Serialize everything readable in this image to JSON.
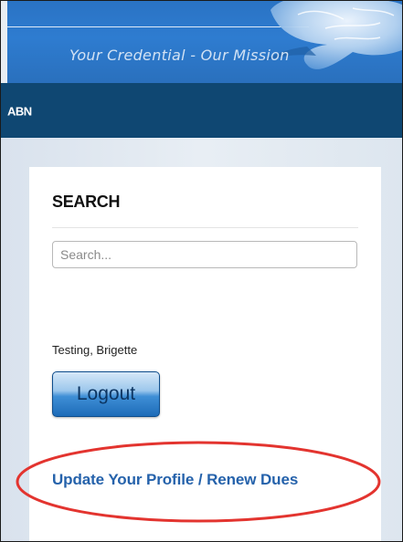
{
  "header": {
    "tagline": "Your Credential - Our Mission"
  },
  "nav": {
    "items": [
      {
        "label": "ABN"
      }
    ]
  },
  "sidebar": {
    "search": {
      "heading": "SEARCH",
      "placeholder": "Search...",
      "value": ""
    },
    "user": {
      "name": "Testing, Brigette"
    },
    "logout_label": "Logout",
    "profile_link_label": "Update Your Profile / Renew Dues"
  },
  "colors": {
    "header_blue": "#2e7cd0",
    "navbar": "#0f4772",
    "link": "#2562ab",
    "annotation": "#e3342f"
  },
  "icons": [
    "brain-icon"
  ]
}
